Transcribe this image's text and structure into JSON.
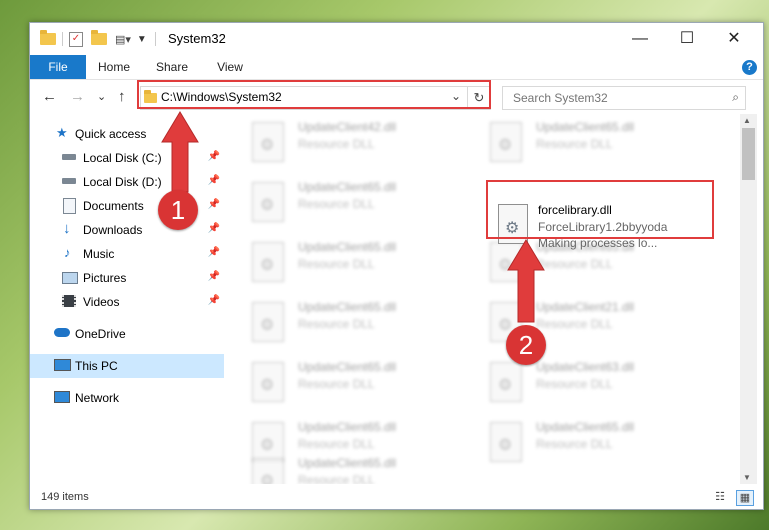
{
  "window": {
    "title": "System32",
    "minimize": "—",
    "maximize": "☐",
    "close": "✕"
  },
  "ribbon": {
    "tabs": [
      "File",
      "Home",
      "Share",
      "View"
    ],
    "help": "?"
  },
  "navigation": {
    "back": "←",
    "forward": "→",
    "recent": "⌄",
    "up": "↑",
    "address": "C:\\Windows\\System32",
    "address_dropdown": "⌄",
    "refresh": "↻",
    "search_placeholder": "Search System32"
  },
  "sidebar": {
    "items": [
      {
        "label": "Quick access",
        "icon": "star-icon",
        "pinned": false
      },
      {
        "label": "Local Disk (C:)",
        "icon": "drive-icon",
        "pinned": true
      },
      {
        "label": "Local Disk (D:)",
        "icon": "drive-icon",
        "pinned": true
      },
      {
        "label": "Documents",
        "icon": "document-icon",
        "pinned": true
      },
      {
        "label": "Downloads",
        "icon": "download-icon",
        "pinned": true
      },
      {
        "label": "Music",
        "icon": "music-icon",
        "pinned": true
      },
      {
        "label": "Pictures",
        "icon": "picture-icon",
        "pinned": true
      },
      {
        "label": "Videos",
        "icon": "video-icon",
        "pinned": true
      },
      {
        "label": "OneDrive",
        "icon": "cloud-icon",
        "pinned": false
      },
      {
        "label": "This PC",
        "icon": "computer-icon",
        "pinned": false,
        "selected": true
      },
      {
        "label": "Network",
        "icon": "network-icon",
        "pinned": false
      }
    ],
    "pin_glyph": "📌"
  },
  "files": {
    "left": [
      {
        "name": "UpdateClient42.dll",
        "type": "Resource DLL"
      },
      {
        "name": "UpdateClient65.dll",
        "type": "Resource DLL"
      },
      {
        "name": "UpdateClient65.dll",
        "type": "Resource DLL"
      },
      {
        "name": "UpdateClient65.dll",
        "type": "Resource DLL"
      },
      {
        "name": "UpdateClient65.dll",
        "type": "Resource DLL"
      },
      {
        "name": "UpdateClient65.dll",
        "type": "Resource DLL"
      },
      {
        "name": "UpdateClient65.dll",
        "type": "Resource DLL"
      }
    ],
    "right": [
      {
        "name": "UpdateClient65.dll",
        "type": "Resource DLL"
      },
      {
        "name": "UpdateClient65.dll",
        "type": "Resource DLL"
      },
      {
        "name": "UpdateClient21.dll",
        "type": "Resource DLL"
      },
      {
        "name": "UpdateClient63.dll",
        "type": "Resource DLL"
      },
      {
        "name": "UpdateClient65.dll",
        "type": "Resource DLL"
      }
    ],
    "focus": {
      "name": "forcelibrary.dll",
      "type": "ForceLibrary1.2bbyyoda",
      "desc": "Making processes lo..."
    }
  },
  "status": {
    "count": "149 items"
  },
  "annotations": {
    "step1": "1",
    "step2": "2",
    "color": "#e03c3c"
  }
}
